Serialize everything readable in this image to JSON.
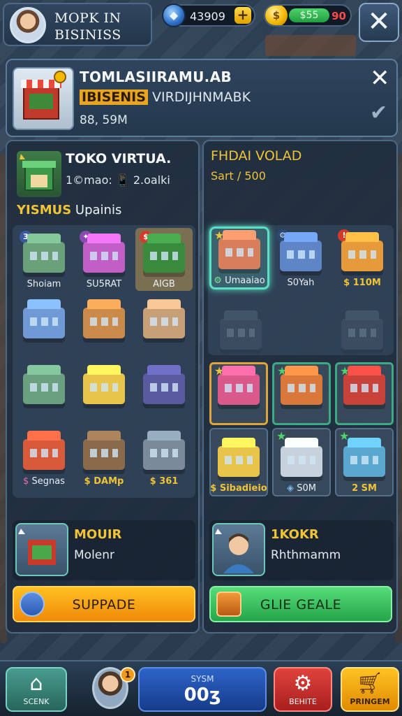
{
  "topbar": {
    "profile_name_line1": "MOPK IN",
    "profile_name_line2": "BISINISS",
    "gems": "43909",
    "gem_plus": "+",
    "coins_green": "$55",
    "coins_red": "90",
    "close": "✕"
  },
  "info_panel": {
    "title": "TOMLASIIRAMU.AB",
    "sub_highlight": "IBISENIS",
    "sub_rest": "VIRDIJHNMABK",
    "price": "88, 59M",
    "close": "✕",
    "check": "✔"
  },
  "left_panel": {
    "title": "TOKO VIRTUA.",
    "subtitle": "1©mao: 📱 2.oalki",
    "row_highlight": "YISMUS",
    "row_rest": "Upainis",
    "items": [
      {
        "label": "Shoiam",
        "badge": "3",
        "color": "#6aa07a"
      },
      {
        "label": "SU5RAT",
        "badge": "✦",
        "color": "#c25fc6"
      },
      {
        "label": "AIGB",
        "badge": "$",
        "color": "#3a8a3e"
      },
      {
        "label": "",
        "color": "#6f9ad6"
      },
      {
        "label": "",
        "color": "#c98a4a"
      },
      {
        "label": "",
        "color": "#c8a078"
      },
      {
        "label": "",
        "color": "#6aa080"
      },
      {
        "label": "",
        "color": "#e8c44a"
      },
      {
        "label": "",
        "color": "#5a5aa0"
      },
      {
        "label": "Segnas",
        "badge": "$",
        "color": "#d95a3a"
      },
      {
        "label": "DAMp",
        "badge": "$",
        "color": "#8a6a4a"
      },
      {
        "label": "361",
        "badge": "$",
        "color": "#7a8a9a"
      }
    ],
    "worker_title": "MOUIR",
    "worker_sub": "Molenr",
    "button_label": "SUPPADE"
  },
  "right_panel": {
    "title": "FHDAI VOLAD",
    "subtitle": "Sart / 500",
    "items_top": [
      {
        "label": "Umaaiao",
        "badge": "⚙",
        "color": "#d97e5a"
      },
      {
        "label": "S0Yah",
        "badge": "⚙",
        "color": "#5e86c6"
      },
      {
        "label": "110M",
        "badge": "$",
        "color": "#e69a3a"
      }
    ],
    "items_bottom": [
      {
        "label": "",
        "color": "#d95a8a"
      },
      {
        "label": "",
        "color": "#d9783a"
      },
      {
        "label": "",
        "color": "#c8423a"
      },
      {
        "label": "Sibadieio",
        "badge": "$",
        "color": "#e8c44a"
      },
      {
        "label": "S0M",
        "badge": "◈",
        "color": "#c8d2dc"
      },
      {
        "label": "2 SM",
        "color": "#5aa8d0"
      }
    ],
    "worker_title": "1KOKR",
    "worker_sub": "Rhthmamm",
    "button_label": "GLIE GEALE"
  },
  "bottombar": {
    "home_label": "SCENK",
    "notify": "1",
    "center_top": "SYSM",
    "center_value": "00ʒ",
    "settings_label": "BEHITE",
    "shop_label": "PRINGEM"
  },
  "colors": {
    "accent_gold": "#f1c437",
    "orange_button": "#f7a31a",
    "green_button": "#3cc35f",
    "panel": "#24384d"
  }
}
